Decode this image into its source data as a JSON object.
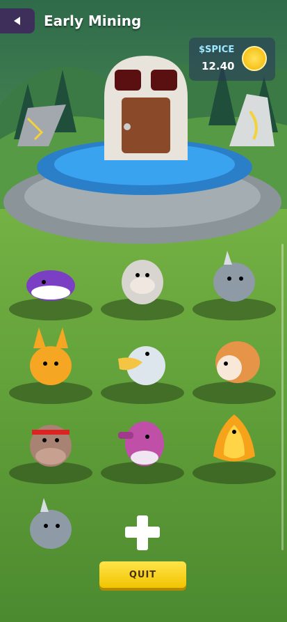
{
  "header": {
    "title": "Early Mining",
    "back_icon": "arrow-left-icon"
  },
  "currency": {
    "label": "$SPICE",
    "value": "12.40",
    "icon": "gold-coin-icon"
  },
  "pets": [
    {
      "name": "whale"
    },
    {
      "name": "yeti"
    },
    {
      "name": "rhino"
    },
    {
      "name": "fox"
    },
    {
      "name": "pelican"
    },
    {
      "name": "hedgehog"
    },
    {
      "name": "hippo"
    },
    {
      "name": "seahorse"
    },
    {
      "name": "phoenix"
    },
    {
      "name": "rhino"
    }
  ],
  "add_slot": {
    "icon": "plus-icon"
  },
  "footer": {
    "quit_label": "QUIT"
  }
}
